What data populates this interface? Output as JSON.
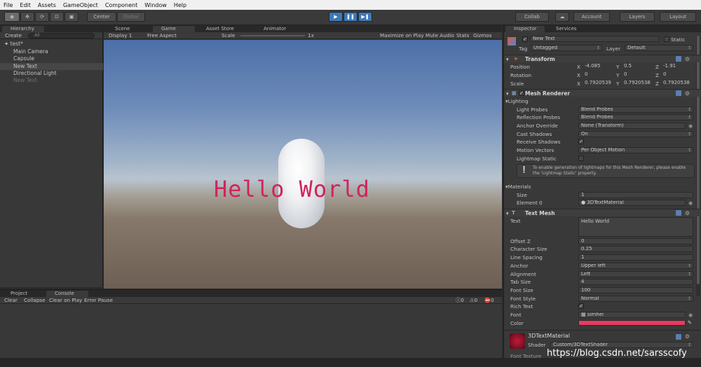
{
  "menu": [
    "File",
    "Edit",
    "Assets",
    "GameObject",
    "Component",
    "Window",
    "Help"
  ],
  "toolbar": {
    "center": "Center",
    "global": "Global",
    "collab": "Collab",
    "account": "Account",
    "layers": "Layers",
    "layout": "Layout"
  },
  "hierarchy": {
    "tab": "Hierarchy",
    "create": "Create",
    "search_all": "All",
    "scene": "test*",
    "items": [
      "Main Camera",
      "Capsule",
      "New Text",
      "Directional Light",
      "New Text"
    ]
  },
  "game": {
    "tabs": [
      "Scene",
      "Game",
      "Asset Store",
      "Animator"
    ],
    "display": "Display 1",
    "aspect": "Free Aspect",
    "scale_label": "Scale",
    "scale_value": "1x",
    "right": [
      "Maximize on Play",
      "Mute Audio",
      "Stats",
      "Gizmos"
    ],
    "text3d": "Hello World"
  },
  "console": {
    "tabs": [
      "Project",
      "Console"
    ],
    "buttons": [
      "Clear",
      "Collapse",
      "Clear on Play",
      "Error Pause"
    ],
    "counts": [
      "0",
      "0",
      "0"
    ]
  },
  "inspector": {
    "tabs": [
      "Inspector",
      "Services"
    ],
    "object_name": "New Text",
    "static": "Static",
    "tag_label": "Tag",
    "tag": "Untagged",
    "layer_label": "Layer",
    "layer": "Default",
    "transform": {
      "title": "Transform",
      "rows": [
        {
          "label": "Position",
          "x": "-4.085",
          "y": "0.5",
          "z": "-1.91"
        },
        {
          "label": "Rotation",
          "x": "0",
          "y": "0",
          "z": "0"
        },
        {
          "label": "Scale",
          "x": "0.7920539",
          "y": "0.7920538",
          "z": "0.7920538"
        }
      ]
    },
    "mesh_renderer": {
      "title": "Mesh Renderer",
      "lighting": "Lighting",
      "rows": [
        {
          "label": "Light Probes",
          "value": "Blend Probes"
        },
        {
          "label": "Reflection Probes",
          "value": "Blend Probes"
        },
        {
          "label": "Anchor Override",
          "value": "None (Transform)"
        },
        {
          "label": "Cast Shadows",
          "value": "On"
        },
        {
          "label": "Receive Shadows",
          "value": "✓"
        },
        {
          "label": "Motion Vectors",
          "value": "Per Object Motion"
        },
        {
          "label": "Lightmap Static",
          "value": ""
        }
      ],
      "info": "To enable generation of lightmaps for this Mesh Renderer, please enable the 'Lightmap Static' property.",
      "materials": "Materials",
      "size_label": "Size",
      "size": "1",
      "element_label": "Element 0",
      "element": "3DTextMaterial"
    },
    "text_mesh": {
      "title": "Text Mesh",
      "text_label": "Text",
      "text": "Hello World",
      "rows": [
        {
          "label": "Offset Z",
          "value": "0"
        },
        {
          "label": "Character Size",
          "value": "0.25"
        },
        {
          "label": "Line Spacing",
          "value": "1"
        },
        {
          "label": "Anchor",
          "value": "Upper left"
        },
        {
          "label": "Alignment",
          "value": "Left"
        },
        {
          "label": "Tab Size",
          "value": "4"
        },
        {
          "label": "Font Size",
          "value": "100"
        },
        {
          "label": "Font Style",
          "value": "Normal"
        },
        {
          "label": "Rich Text",
          "value": "✓"
        },
        {
          "label": "Font",
          "value": "simhei"
        },
        {
          "label": "Color",
          "value": ""
        }
      ],
      "color": "#e83a62"
    },
    "material": {
      "name": "3DTextMaterial",
      "shader_label": "Shader",
      "shader": "Custom/3DTextShader",
      "last": "Font Texture"
    }
  },
  "watermark": "https://blog.csdn.net/sarsscofy"
}
